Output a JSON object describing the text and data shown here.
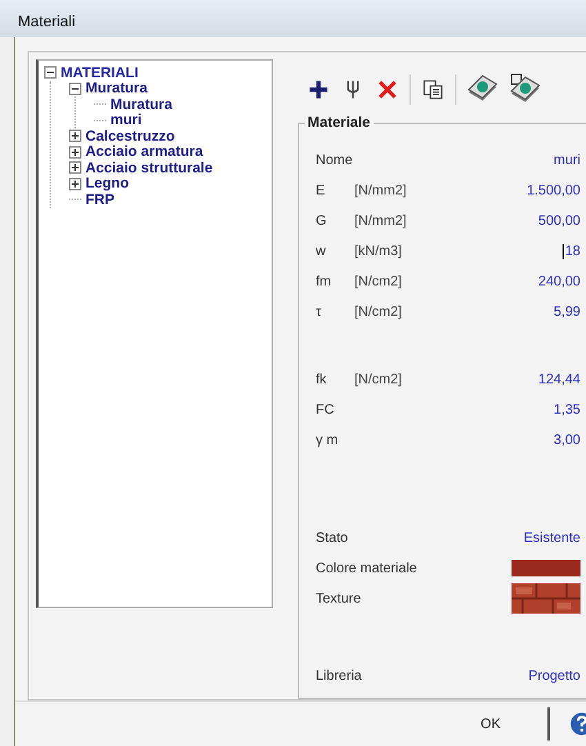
{
  "window": {
    "title": "Materiali"
  },
  "tree": [
    {
      "label": "MATERIALI",
      "expanded": true,
      "children": [
        {
          "label": "Muratura",
          "expanded": true,
          "children": [
            {
              "label": "Muratura"
            },
            {
              "label": "muri"
            }
          ]
        },
        {
          "label": "Calcestruzzo",
          "expanded": false
        },
        {
          "label": "Acciaio armatura",
          "expanded": false
        },
        {
          "label": "Acciaio strutturale",
          "expanded": false
        },
        {
          "label": "Legno",
          "expanded": false
        },
        {
          "label": "FRP"
        }
      ]
    }
  ],
  "toolbar": [
    {
      "kind": "add"
    },
    {
      "kind": "fork"
    },
    {
      "kind": "delete"
    },
    {
      "kind": "separator"
    },
    {
      "kind": "copy"
    },
    {
      "kind": "separator"
    },
    {
      "kind": "book"
    },
    {
      "kind": "book-save"
    }
  ],
  "group": {
    "title": "Materiale",
    "sections": [
      [
        {
          "kind": "value",
          "name": "Nome",
          "value": "muri"
        },
        {
          "kind": "value",
          "name": "E",
          "unit": "[N/mm2]",
          "value": "1.500,00"
        },
        {
          "kind": "value",
          "name": "G",
          "unit": "[N/mm2]",
          "value": "500,00"
        },
        {
          "kind": "value",
          "name": "w",
          "unit": "[kN/m3]",
          "value": "18",
          "editing": true
        },
        {
          "kind": "value",
          "name": "fm",
          "unit": "[N/cm2]",
          "value": "240,00"
        },
        {
          "kind": "value",
          "name": "τ",
          "unit": "[N/cm2]",
          "value": "5,99"
        }
      ],
      [
        {
          "kind": "value",
          "name": "fk",
          "unit": "[N/cm2]",
          "value": "124,44"
        },
        {
          "kind": "value",
          "name": "FC",
          "value": "1,35"
        },
        {
          "kind": "value",
          "name": "γ m",
          "value": "3,00"
        }
      ],
      [
        {
          "kind": "value",
          "name": "Stato",
          "value": "Esistente"
        },
        {
          "kind": "color",
          "name": "Colore materiale",
          "color": "#9b2a1e"
        },
        {
          "kind": "texture",
          "name": "Texture"
        }
      ],
      [
        {
          "kind": "value",
          "name": "Libreria",
          "value": "Progetto"
        }
      ]
    ]
  },
  "buttons": [
    {
      "kind": "text",
      "label": "OK"
    },
    {
      "kind": "help"
    }
  ]
}
